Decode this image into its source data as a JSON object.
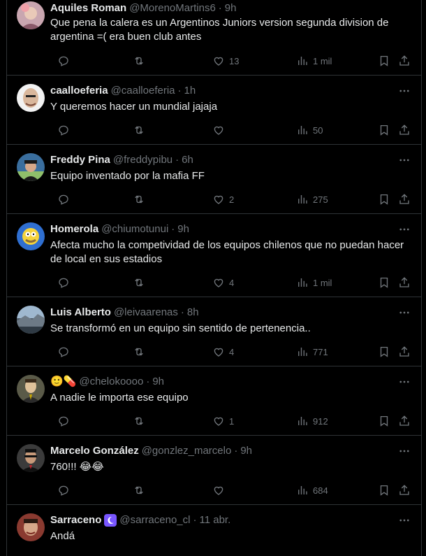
{
  "tweets": [
    {
      "name": "Aquiles Roman",
      "handle": "@MorenoMartins6",
      "time": "9h",
      "text": "Que pena la calera es un Argentinos Juniors version segunda division de argentina =( era buen club antes",
      "likes": "13",
      "views": "1 mil",
      "avatar_color": "#c9a6b0"
    },
    {
      "name": "caalloeferia",
      "handle": "@caalloeferia",
      "time": "1h",
      "text": "Y queremos hacer un mundial jajaja",
      "likes": "",
      "views": "50",
      "avatar_color": "#d4c2b0"
    },
    {
      "name": "Freddy Pina",
      "handle": "@freddypibu",
      "time": "6h",
      "text": "Equipo inventado por la mafia FF",
      "likes": "2",
      "views": "275",
      "avatar_color": "#3a6e9e"
    },
    {
      "name": "Homerola",
      "handle": "@chiumotunui",
      "time": "9h",
      "text": "Afecta mucho la competividad de los equipos chilenos que no puedan hacer de local en sus estadios",
      "likes": "4",
      "views": "1 mil",
      "avatar_color": "#2f6fd1"
    },
    {
      "name": "Luis Alberto",
      "handle": "@leivaarenas",
      "time": "8h",
      "text": "Se transformó en un equipo sin sentido de pertenencia..",
      "likes": "4",
      "views": "771",
      "avatar_color": "#6f8fa8"
    },
    {
      "name": "🙂💊",
      "handle": "@chelokoooo",
      "time": "9h",
      "text": "A nadie le importa ese equipo",
      "likes": "1",
      "views": "912",
      "avatar_color": "#4a4a40"
    },
    {
      "name": "Marcelo González",
      "handle": "@gonzlez_marcelo",
      "time": "9h",
      "text": "760!!! 😂😂",
      "likes": "",
      "views": "684",
      "avatar_color": "#3b3b3b"
    },
    {
      "name": "Sarraceno",
      "handle": "@sarraceno_cl",
      "time": "11 abr.",
      "text": "Andá",
      "likes": "",
      "views": "",
      "avatar_color": "#7a4a3a",
      "badge": "🌙"
    }
  ],
  "colors": {
    "background": "#000000",
    "text": "#e7e9ea",
    "muted": "#71767b",
    "divider": "#2f3336",
    "badge": "#7856ff"
  }
}
